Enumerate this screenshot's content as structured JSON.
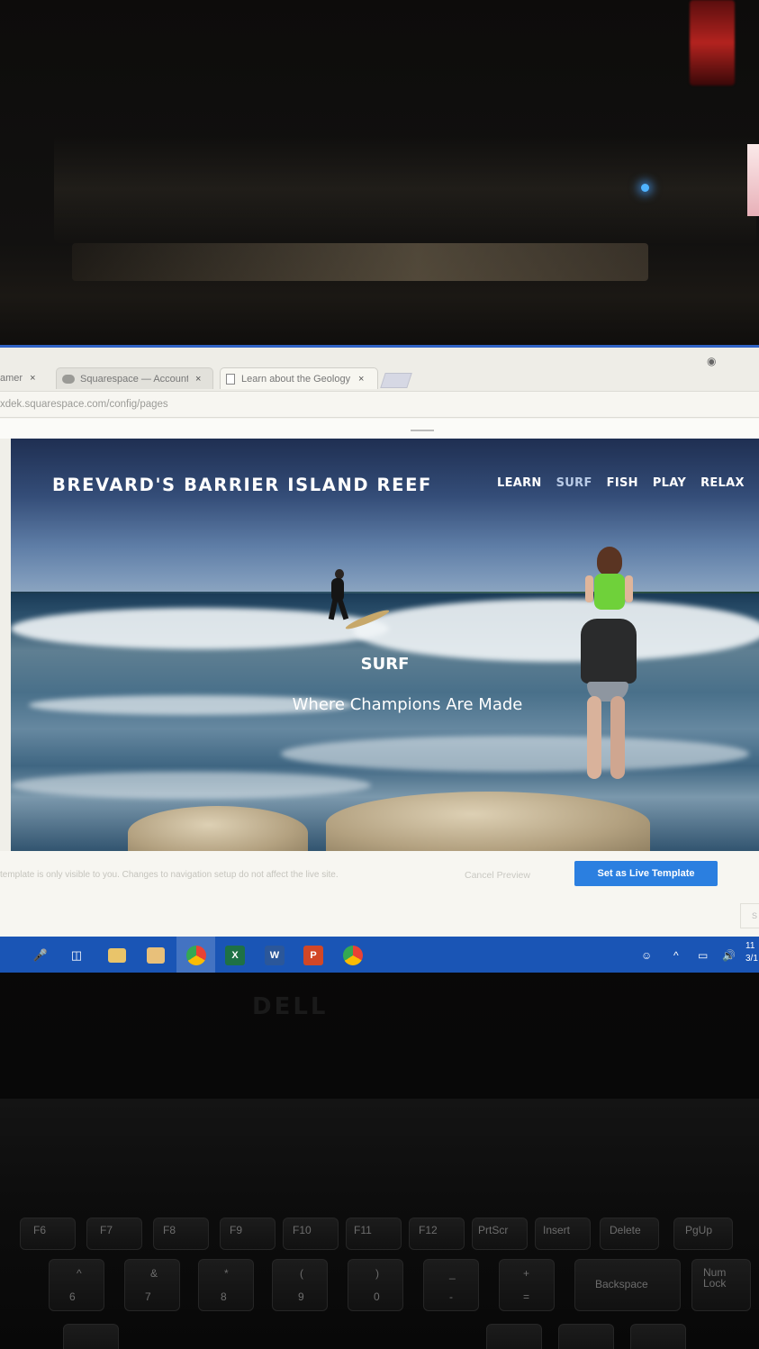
{
  "browser": {
    "tabs": [
      {
        "label": "amer",
        "close": "×"
      },
      {
        "label": "Squarespace — Account",
        "close": "×",
        "icon": "squarespace-icon"
      },
      {
        "label": "Learn about the Geology",
        "close": "×",
        "icon": "document-icon"
      }
    ],
    "url": "xdek.squarespace.com/config/pages"
  },
  "site": {
    "title": "BREVARD'S BARRIER ISLAND REEF",
    "nav": [
      {
        "label": "LEARN",
        "active": false
      },
      {
        "label": "SURF",
        "active": true
      },
      {
        "label": "FISH",
        "active": false
      },
      {
        "label": "PLAY",
        "active": false
      },
      {
        "label": "RELAX",
        "active": false
      }
    ],
    "hero": {
      "heading": "SURF",
      "subheading": "Where Champions Are Made"
    }
  },
  "preview_bar": {
    "notice": "template is only visible to you. Changes to navigation setup do not affect the live site.",
    "cancel_label": "Cancel Preview",
    "live_button_label": "Set as Live Template",
    "edge_label": "S"
  },
  "taskbar": {
    "icons": [
      "microphone-icon",
      "task-view-icon",
      "file-explorer-icon",
      "store-icon",
      "chrome-icon",
      "excel-icon",
      "word-icon",
      "powerpoint-icon",
      "chrome-alt-icon"
    ],
    "clock_time": "11",
    "clock_date": "3/1"
  },
  "laptop": {
    "brand": "DELL",
    "keys_top": [
      "F6",
      "F7",
      "F8",
      "F9",
      "F10",
      "F11",
      "F12",
      "PrtScr",
      "Insert",
      "Delete",
      "PgUp"
    ],
    "keys_num": [
      "6",
      "7",
      "8",
      "9",
      "0",
      "-",
      "="
    ],
    "keys_shift": [
      "^",
      "&",
      "*",
      "(",
      ")",
      "_",
      "+"
    ],
    "backspace": "Backspace",
    "numlock": "Num Lock"
  },
  "colors": {
    "accent": "#2b7fe0",
    "taskbar": "#1a55b5",
    "nav_active": "#b9cbe6"
  }
}
